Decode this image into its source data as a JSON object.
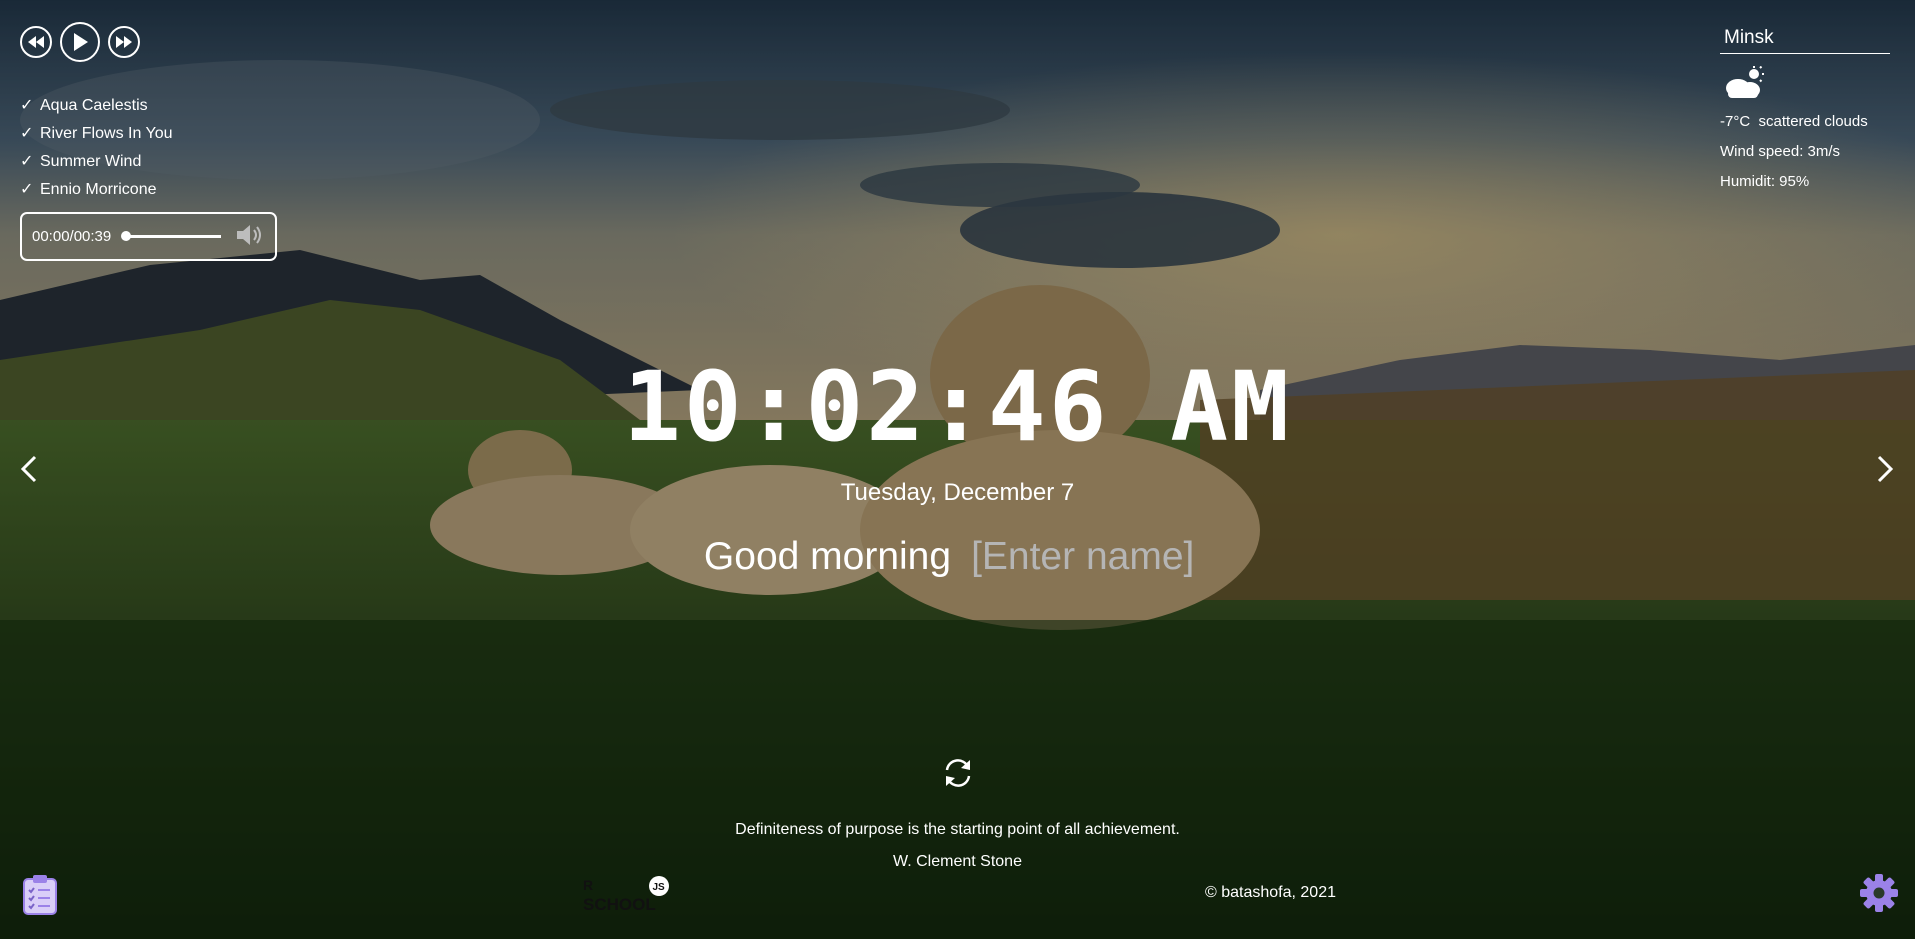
{
  "player": {
    "controls": {
      "prev_icon": "rewind-icon",
      "play_icon": "play-icon",
      "next_icon": "fast-forward-icon"
    },
    "playlist": [
      {
        "check": "✓",
        "title": "Aqua Caelestis"
      },
      {
        "check": "✓",
        "title": "River Flows In You"
      },
      {
        "check": "✓",
        "title": "Summer Wind"
      },
      {
        "check": "✓",
        "title": "Ennio Morricone"
      }
    ],
    "time_display": "00:00/00:39",
    "progress": 0,
    "volume_icon": "volume-icon"
  },
  "weather": {
    "city": "Minsk",
    "icon": "cloud-sun-icon",
    "temperature": "-7°C",
    "description": "scattered clouds",
    "wind": "Wind speed: 3m/s",
    "humidity": "Humidit: 95%"
  },
  "clock": {
    "time": "10:02:46 AM",
    "date": "Tuesday, December 7"
  },
  "greeting": {
    "text": "Good morning",
    "name_placeholder": "[Enter name]",
    "name_value": ""
  },
  "slider": {
    "prev_icon": "chevron-left-icon",
    "next_icon": "chevron-right-icon"
  },
  "quote": {
    "refresh_icon": "refresh-icon",
    "text": "Definiteness of purpose is the starting point of all achievement.",
    "author": "W. Clement Stone"
  },
  "footer": {
    "todo_icon": "clipboard-checklist-icon",
    "logo": "rs-school-logo",
    "copyright": "© batashofa, 2021",
    "settings_icon": "gear-icon"
  },
  "colors": {
    "accent": "#9b82e8",
    "text": "#ffffff",
    "placeholder": "#b5b5b5"
  }
}
